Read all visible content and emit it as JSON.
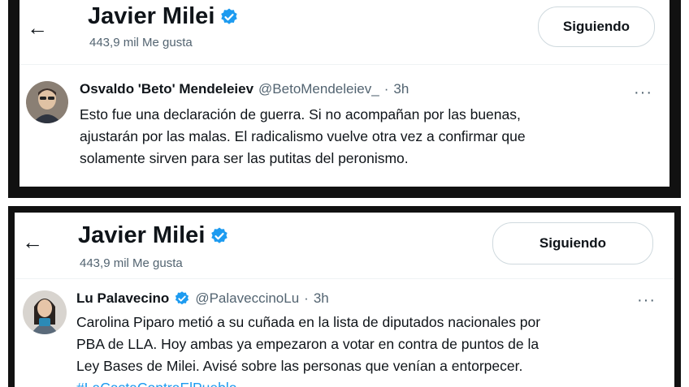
{
  "colors": {
    "verified_blue": "#1d9bf0",
    "secondary_text": "#536471",
    "hashtag": "#1d9bf0",
    "frame": "#111111"
  },
  "screenshots": [
    {
      "header": {
        "back_icon": "arrow-left-icon",
        "profile_name": "Javier Milei",
        "verified_icon": "verified-badge-icon",
        "likes": "443,9 mil Me gusta",
        "follow_button": "Siguiendo"
      },
      "tweet": {
        "author_name": "Osvaldo 'Beto' Mendeleiev",
        "handle": "@BetoMendeleiev_",
        "separator": "·",
        "time": "3h",
        "more_icon": "more-horizontal-icon",
        "text_lines": [
          "Esto fue una declaración de guerra. Si no acompañan por las buenas,",
          "ajustarán por las malas. El radicalismo vuelve otra vez a confirmar que",
          "solamente sirven para ser las putitas del peronismo."
        ]
      }
    },
    {
      "header": {
        "back_icon": "arrow-left-icon",
        "profile_name": "Javier Milei",
        "verified_icon": "verified-badge-icon",
        "likes": "443,9 mil Me gusta",
        "follow_button": "Siguiendo"
      },
      "tweet": {
        "author_name": "Lu Palavecino",
        "handle": "@PalaveccinoLu",
        "separator": "·",
        "time": "3h",
        "more_icon": "more-horizontal-icon",
        "text_lines": [
          "Carolina Piparo metió a su cuñada en la lista de diputados nacionales por",
          "PBA de LLA. Hoy ambas ya empezaron a votar en contra de puntos de la",
          "Ley Bases de Milei. Avisé sobre las personas que venían a entorpecer."
        ],
        "hashtag": "#LaCastaContraElPueblo"
      }
    }
  ]
}
